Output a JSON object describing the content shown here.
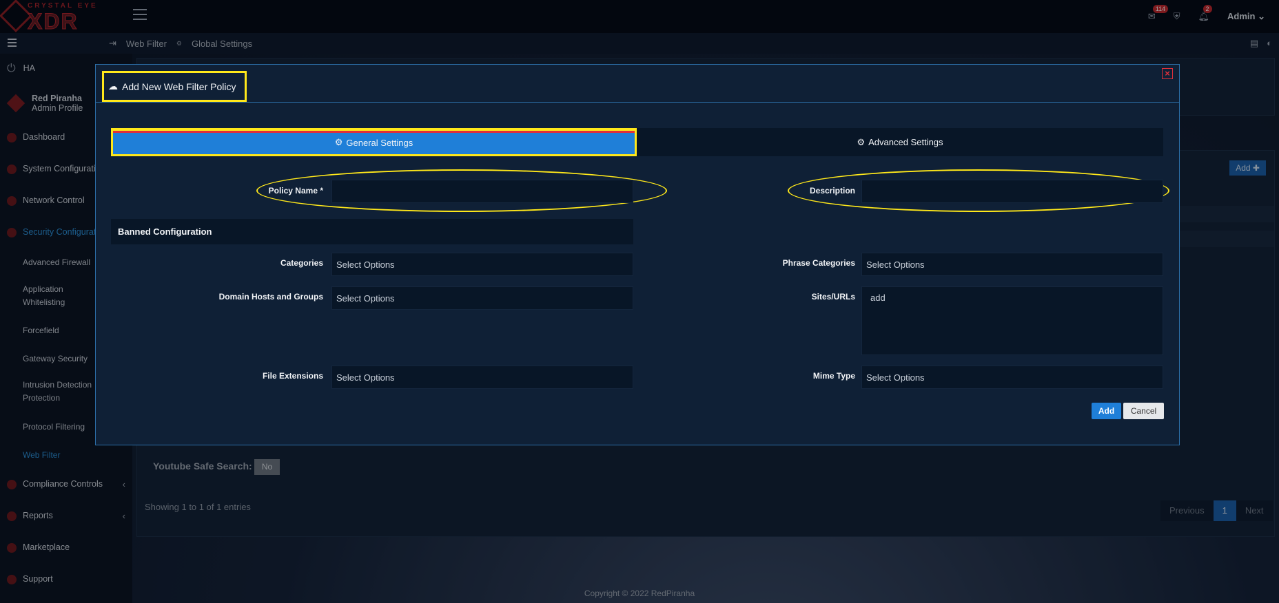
{
  "brand": {
    "tagline": "CRYSTAL EYE",
    "name": "XDR"
  },
  "topbar": {
    "mail_count": "114",
    "alert_count": "2",
    "user": "Admin"
  },
  "breadcrumb": {
    "section": "Web Filter",
    "page": "Global Settings"
  },
  "sidebar": {
    "ha": "HA",
    "profile_name": "Red Piranha",
    "profile_sub": "Admin Profile",
    "items": [
      "Dashboard",
      "System Configuratio",
      "Network Control",
      "Security Configurat"
    ],
    "sub_items": [
      "Advanced Firewall",
      "Application Whitelisting",
      "Forcefield",
      "Gateway Security",
      "Intrusion Detection Protection",
      "Protocol Filtering",
      "Web Filter"
    ],
    "bottom_items": [
      "Compliance Controls",
      "Reports",
      "Marketplace",
      "Support"
    ]
  },
  "background": {
    "add_label": "Add ✚",
    "youtube_label": "Youtube Safe Search:",
    "youtube_value": "No",
    "showing": "Showing 1 to 1 of 1 entries",
    "pager": [
      "Previous",
      "1",
      "Next"
    ],
    "copyright": "Copyright © 2022 RedPiranha"
  },
  "modal": {
    "title": "Add New Web Filter Policy",
    "close": "×",
    "tabs": [
      "General Settings",
      "Advanced Settings"
    ],
    "fields": {
      "policy_name": {
        "label": "Policy Name *",
        "value": ""
      },
      "description": {
        "label": "Description",
        "value": ""
      },
      "section_title": "Banned Configuration",
      "categories": {
        "label": "Categories",
        "placeholder": "Select Options"
      },
      "phrase_categories": {
        "label": "Phrase Categories",
        "placeholder": "Select Options"
      },
      "domain_hosts": {
        "label": "Domain Hosts and Groups",
        "placeholder": "Select Options"
      },
      "sites_urls": {
        "label": "Sites/URLs",
        "placeholder": "add"
      },
      "file_extensions": {
        "label": "File Extensions",
        "placeholder": "Select Options"
      },
      "mime_type": {
        "label": "Mime Type",
        "placeholder": "Select Options"
      }
    },
    "add_button": "Add",
    "cancel_button": "Cancel"
  },
  "colors": {
    "accent": "#1f7fd8",
    "highlight": "#ffe81a",
    "danger": "#e0303a"
  }
}
